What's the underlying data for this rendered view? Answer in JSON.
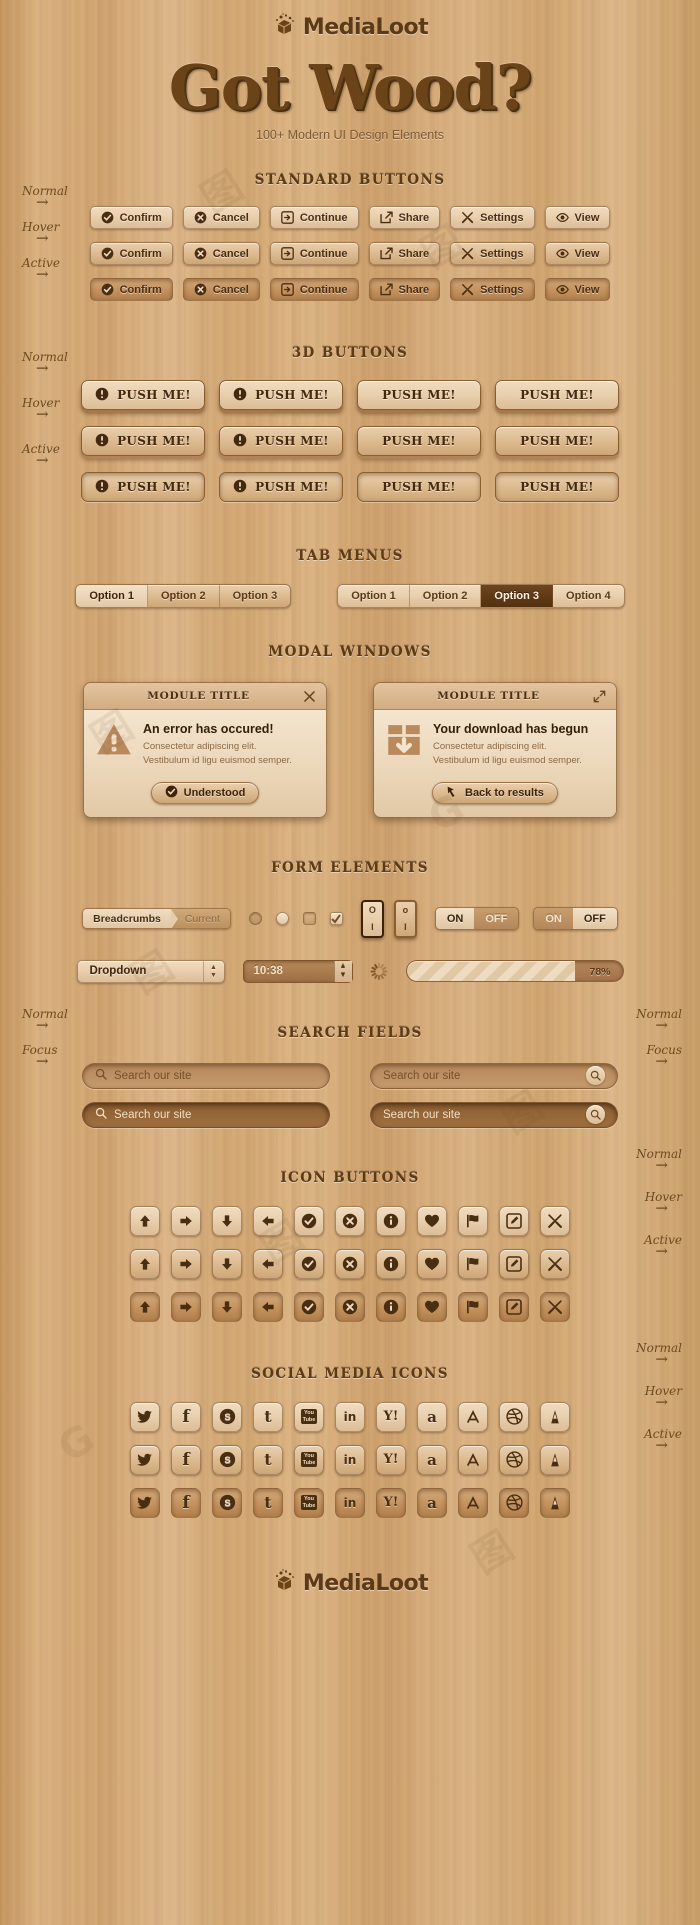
{
  "brand": {
    "name": "MediaLoot",
    "logo_icon": "wood-splash-logo-icon"
  },
  "hero": {
    "title": "Got Wood?",
    "subtitle": "100+ Modern UI Design Elements"
  },
  "states": {
    "normal": "Normal",
    "hover": "Hover",
    "active": "Active",
    "focus": "Focus"
  },
  "sections": {
    "standard_buttons": "STANDARD BUTTONS",
    "three_d_buttons": "3D BUTTONS",
    "tab_menus": "TAB MENUS",
    "modal_windows": "MODAL WINDOWS",
    "form_elements": "FORM ELEMENTS",
    "search_fields": "SEARCH FIELDS",
    "icon_buttons": "ICON BUTTONS",
    "social_media_icons": "SOCIAL MEDIA ICONS"
  },
  "standard_buttons": [
    {
      "label": "Confirm",
      "icon": "check-circle-icon"
    },
    {
      "label": "Cancel",
      "icon": "x-circle-icon"
    },
    {
      "label": "Continue",
      "icon": "arrow-right-box-icon"
    },
    {
      "label": "Share",
      "icon": "share-external-icon"
    },
    {
      "label": "Settings",
      "icon": "tools-cross-icon"
    },
    {
      "label": "View",
      "icon": "eye-icon"
    }
  ],
  "three_d_buttons": [
    {
      "label": "PUSH ME!",
      "icon": "exclamation-circle-icon"
    },
    {
      "label": "PUSH ME!",
      "icon": "exclamation-circle-icon"
    },
    {
      "label": "PUSH ME!",
      "icon": "none"
    },
    {
      "label": "PUSH ME!",
      "icon": "none"
    }
  ],
  "tab_menus": {
    "left": {
      "options": [
        "Option 1",
        "Option 2",
        "Option 3"
      ],
      "selected": 0,
      "style": "light"
    },
    "right": {
      "options": [
        "Option 1",
        "Option 2",
        "Option 3",
        "Option 4"
      ],
      "selected": 2,
      "style": "dark"
    }
  },
  "modals": [
    {
      "title": "MODULE TITLE",
      "action_icon": "close-icon",
      "icon": "warning-triangle-icon",
      "heading": "An error has occured!",
      "body_line1": "Consectetur adipiscing elit.",
      "body_line2": "Vestibulum id ligu euismod semper.",
      "button": {
        "label": "Understood",
        "icon": "check-circle-icon"
      }
    },
    {
      "title": "MODULE TITLE",
      "action_icon": "expand-icon",
      "icon": "download-box-icon",
      "heading": "Your download has begun",
      "body_line1": "Consectetur adipiscing elit.",
      "body_line2": "Vestibulum id ligu euismod semper.",
      "button": {
        "label": "Back to results",
        "icon": "back-arrow-icon"
      }
    }
  ],
  "form": {
    "breadcrumb": {
      "active": "Breadcrumbs",
      "current": "Current"
    },
    "radios": [
      {
        "name": "radio-unselected",
        "state": "off"
      },
      {
        "name": "radio-selected",
        "state": "on"
      }
    ],
    "checkboxes": [
      {
        "name": "checkbox-unchecked",
        "state": "off"
      },
      {
        "name": "checkbox-checked",
        "state": "on",
        "mark": "✓"
      }
    ],
    "rocker_switches": [
      {
        "name": "rocker-switch-dark",
        "top": "O",
        "bottom": "I"
      },
      {
        "name": "rocker-switch-light",
        "top": "o",
        "bottom": "I"
      }
    ],
    "toggles": [
      {
        "on_label": "ON",
        "off_label": "OFF",
        "selected": "ON"
      },
      {
        "on_label": "ON",
        "off_label": "OFF",
        "selected": "OFF"
      }
    ],
    "dropdown": {
      "value": "Dropdown",
      "stepper_up": "▲",
      "stepper_down": "▼"
    },
    "time_input": {
      "value": "10:38",
      "stepper_up": "▲",
      "stepper_down": "▼"
    },
    "spinner": {
      "name": "loading-spinner-icon"
    },
    "progress": {
      "percent": 78,
      "label": "78%"
    }
  },
  "search_fields": [
    {
      "placeholder": "Search our site",
      "icon_side": "left",
      "state": "normal"
    },
    {
      "placeholder": "Search our site",
      "icon_side": "right",
      "state": "normal"
    },
    {
      "placeholder": "Search our site",
      "icon_side": "left",
      "state": "focus"
    },
    {
      "placeholder": "Search our site",
      "icon_side": "right",
      "state": "focus"
    }
  ],
  "icon_buttons": [
    "arrow-up-icon",
    "arrow-right-icon",
    "arrow-down-icon",
    "arrow-left-icon",
    "check-circle-icon",
    "x-circle-icon",
    "info-circle-icon",
    "heart-icon",
    "flag-icon",
    "edit-square-icon",
    "tools-cross-icon"
  ],
  "social_icons": [
    "twitter-icon",
    "facebook-icon",
    "skype-icon",
    "tumblr-icon",
    "youtube-icon",
    "linkedin-icon",
    "yahoo-icon",
    "amazon-icon",
    "appstore-icon",
    "dribbble-icon",
    "evernote-icon"
  ],
  "colors": {
    "wood_base": "#d2a671",
    "wood_light": "#f0dcc0",
    "wood_dark": "#6d4420",
    "ink": "#4a2e12",
    "title": "#5c3a14"
  }
}
